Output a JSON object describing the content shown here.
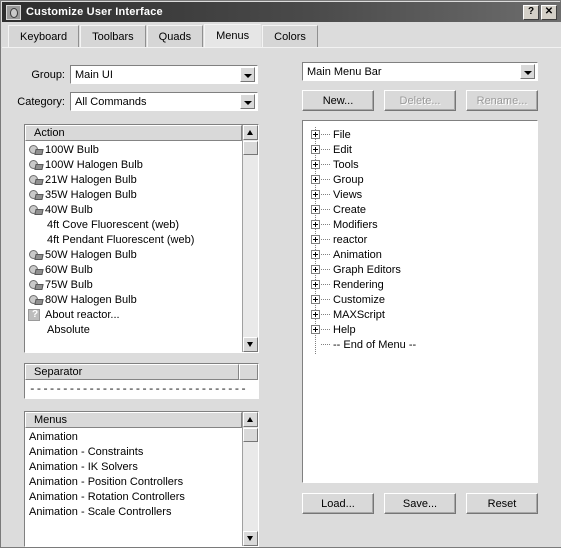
{
  "window": {
    "title": "Customize User Interface",
    "app_icon": "spiral-icon",
    "help_button": "?",
    "close_button": "✕"
  },
  "tabs": [
    {
      "label": "Keyboard",
      "active": false
    },
    {
      "label": "Toolbars",
      "active": false
    },
    {
      "label": "Quads",
      "active": false
    },
    {
      "label": "Menus",
      "active": true
    },
    {
      "label": "Colors",
      "active": false
    }
  ],
  "left": {
    "group_label": "Group:",
    "group_value": "Main UI",
    "category_label": "Category:",
    "category_value": "All Commands",
    "action_header": "Action",
    "actions": [
      {
        "label": "100W Bulb",
        "icon": "bulb"
      },
      {
        "label": "100W Halogen Bulb",
        "icon": "bulb"
      },
      {
        "label": "21W Halogen Bulb",
        "icon": "bulb"
      },
      {
        "label": "35W Halogen Bulb",
        "icon": "bulb"
      },
      {
        "label": "40W Bulb",
        "icon": "bulb"
      },
      {
        "label": "4ft Cove Fluorescent (web)",
        "icon": "none"
      },
      {
        "label": "4ft Pendant Fluorescent (web)",
        "icon": "none"
      },
      {
        "label": "50W Halogen Bulb",
        "icon": "bulb"
      },
      {
        "label": "60W Bulb",
        "icon": "bulb"
      },
      {
        "label": "75W Bulb",
        "icon": "bulb"
      },
      {
        "label": "80W Halogen Bulb",
        "icon": "bulb"
      },
      {
        "label": "About reactor...",
        "icon": "qmark"
      },
      {
        "label": "Absolute",
        "icon": "none"
      }
    ],
    "separator_header": "Separator",
    "separator_value": "---------------------------------",
    "menus_header": "Menus",
    "menus": [
      {
        "label": "Animation"
      },
      {
        "label": "Animation - Constraints"
      },
      {
        "label": "Animation - IK Solvers"
      },
      {
        "label": "Animation - Position Controllers"
      },
      {
        "label": "Animation - Rotation Controllers"
      },
      {
        "label": "Animation - Scale Controllers"
      }
    ]
  },
  "right": {
    "menu_select_value": "Main Menu Bar",
    "new_button": "New...",
    "delete_button": "Delete...",
    "rename_button": "Rename...",
    "tree": [
      {
        "label": "File",
        "type": "branch"
      },
      {
        "label": "Edit",
        "type": "branch"
      },
      {
        "label": "Tools",
        "type": "branch"
      },
      {
        "label": "Group",
        "type": "branch"
      },
      {
        "label": "Views",
        "type": "branch"
      },
      {
        "label": "Create",
        "type": "branch"
      },
      {
        "label": "Modifiers",
        "type": "branch"
      },
      {
        "label": "reactor",
        "type": "branch"
      },
      {
        "label": "Animation",
        "type": "branch"
      },
      {
        "label": "Graph Editors",
        "type": "branch"
      },
      {
        "label": "Rendering",
        "type": "branch"
      },
      {
        "label": "Customize",
        "type": "branch"
      },
      {
        "label": "MAXScript",
        "type": "branch"
      },
      {
        "label": "Help",
        "type": "branch"
      },
      {
        "label": "-- End of Menu --",
        "type": "leaf"
      }
    ],
    "load_button": "Load...",
    "save_button": "Save...",
    "reset_button": "Reset"
  },
  "colors": {
    "dialog_bg": "#dcdcdc",
    "titlebar_dark": "#2e2e2e",
    "titlebar_light": "#6d6d6d",
    "field_bg": "#ffffff",
    "control_face": "#d9d9d9",
    "disabled_text": "#9a9a9a"
  }
}
